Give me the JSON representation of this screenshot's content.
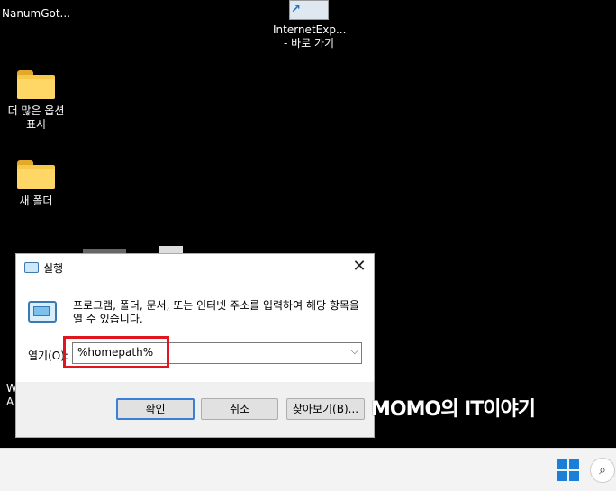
{
  "desktop": {
    "icons": [
      {
        "label": "NanumGot..."
      },
      {
        "label": "더 많은 옵션\n표시"
      },
      {
        "label": "새 폴더"
      },
      {
        "label": "InternetExp...\n- 바로 가기"
      }
    ],
    "partial_texts": [
      "W",
      "A"
    ]
  },
  "dialog": {
    "title": "실행",
    "close_icon": "close-icon",
    "description": "프로그램, 폴더, 문서, 또는 인터넷 주소를 입력하여 해당 항목을 열 수 있습니다.",
    "open_label": "열기(O):",
    "open_value": "%homepath%",
    "ok_label": "확인",
    "cancel_label": "취소",
    "browse_label": "찾아보기(B)..."
  },
  "watermark": "MOMO의 IT이야기",
  "colors": {
    "highlight": "#e0151d",
    "accent": "#3c7fd9",
    "folder": "#f7c94b"
  }
}
